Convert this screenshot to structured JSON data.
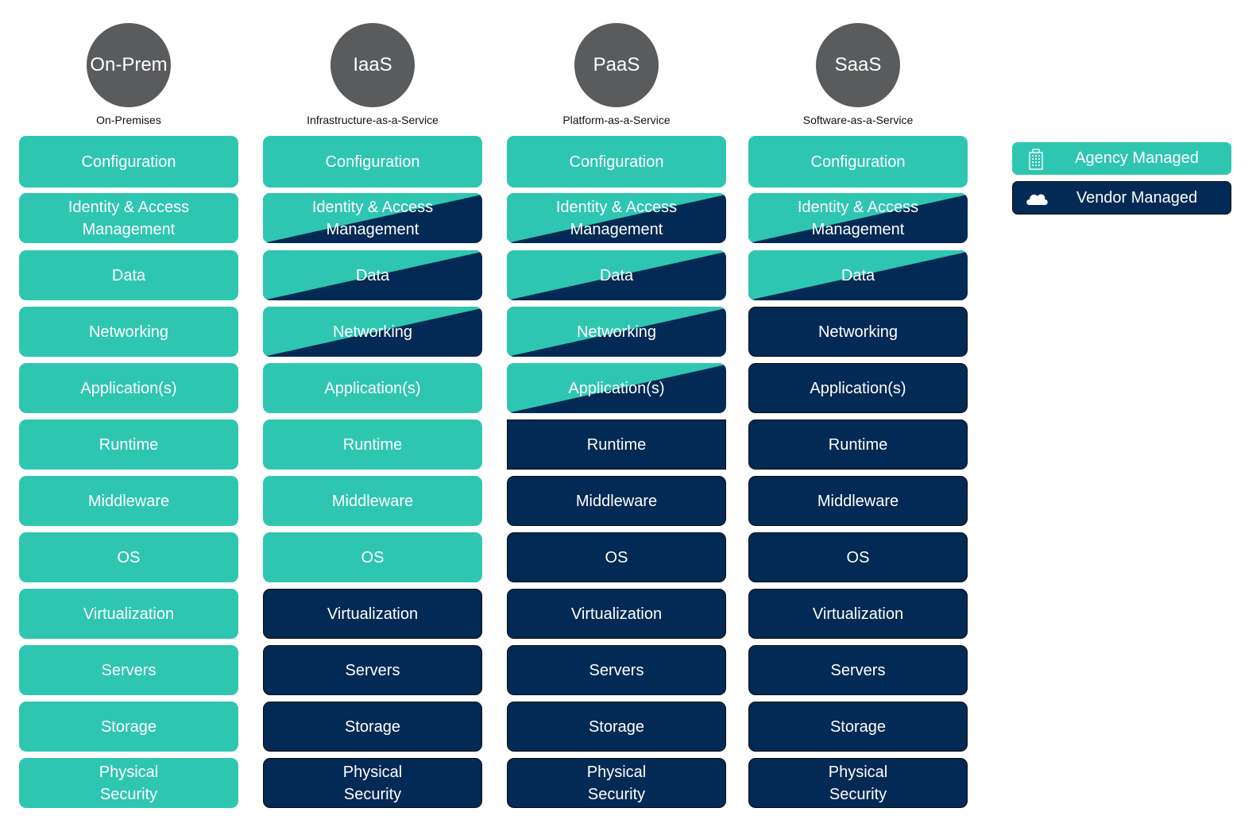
{
  "colors": {
    "agency": "#2fc6b1",
    "vendor": "#022a54",
    "badge": "#5a5b5d",
    "subtitle_text": "#111111"
  },
  "legend": [
    {
      "label": "Agency Managed",
      "icon": "building-icon",
      "type": "agency"
    },
    {
      "label": "Vendor Managed",
      "icon": "cloud-icon",
      "type": "vendor"
    }
  ],
  "columns": [
    {
      "badge": "On-Prem",
      "subtitle": "On-Premises",
      "tiles": [
        {
          "label": "Configuration",
          "type": "agency"
        },
        {
          "label": "Identity & Access Management",
          "type": "agency"
        },
        {
          "label": "Data",
          "type": "agency"
        },
        {
          "label": "Networking",
          "type": "agency"
        },
        {
          "label": "Application(s)",
          "type": "agency"
        },
        {
          "label": "Runtime",
          "type": "agency"
        },
        {
          "label": "Middleware",
          "type": "agency"
        },
        {
          "label": "OS",
          "type": "agency"
        },
        {
          "label": "Virtualization",
          "type": "agency"
        },
        {
          "label": "Servers",
          "type": "agency"
        },
        {
          "label": "Storage",
          "type": "agency"
        },
        {
          "label": "Physical Security",
          "type": "agency"
        }
      ]
    },
    {
      "badge": "IaaS",
      "subtitle": "Infrastructure-as-a-Service",
      "tiles": [
        {
          "label": "Configuration",
          "type": "agency"
        },
        {
          "label": "Identity & Access Management",
          "type": "shared"
        },
        {
          "label": "Data",
          "type": "shared"
        },
        {
          "label": "Networking",
          "type": "shared"
        },
        {
          "label": "Application(s)",
          "type": "agency"
        },
        {
          "label": "Runtime",
          "type": "agency"
        },
        {
          "label": "Middleware",
          "type": "agency"
        },
        {
          "label": "OS",
          "type": "agency"
        },
        {
          "label": "Virtualization",
          "type": "vendor"
        },
        {
          "label": "Servers",
          "type": "vendor"
        },
        {
          "label": "Storage",
          "type": "vendor"
        },
        {
          "label": "Physical Security",
          "type": "vendor"
        }
      ]
    },
    {
      "badge": "PaaS",
      "subtitle": "Platform-as-a-Service",
      "tiles": [
        {
          "label": "Configuration",
          "type": "agency"
        },
        {
          "label": "Identity & Access Management",
          "type": "shared"
        },
        {
          "label": "Data",
          "type": "shared"
        },
        {
          "label": "Networking",
          "type": "shared"
        },
        {
          "label": "Application(s)",
          "type": "shared"
        },
        {
          "label": "Runtime",
          "type": "vendor"
        },
        {
          "label": "Middleware",
          "type": "vendor"
        },
        {
          "label": "OS",
          "type": "vendor"
        },
        {
          "label": "Virtualization",
          "type": "vendor"
        },
        {
          "label": "Servers",
          "type": "vendor"
        },
        {
          "label": "Storage",
          "type": "vendor"
        },
        {
          "label": "Physical Security",
          "type": "vendor"
        }
      ]
    },
    {
      "badge": "SaaS",
      "subtitle": "Software-as-a-Service",
      "tiles": [
        {
          "label": "Configuration",
          "type": "agency"
        },
        {
          "label": "Identity & Access Management",
          "type": "shared"
        },
        {
          "label": "Data",
          "type": "shared"
        },
        {
          "label": "Networking",
          "type": "vendor"
        },
        {
          "label": "Application(s)",
          "type": "vendor"
        },
        {
          "label": "Runtime",
          "type": "vendor"
        },
        {
          "label": "Middleware",
          "type": "vendor"
        },
        {
          "label": "OS",
          "type": "vendor"
        },
        {
          "label": "Virtualization",
          "type": "vendor"
        },
        {
          "label": "Servers",
          "type": "vendor"
        },
        {
          "label": "Storage",
          "type": "vendor"
        },
        {
          "label": "Physical Security",
          "type": "vendor"
        }
      ]
    }
  ]
}
